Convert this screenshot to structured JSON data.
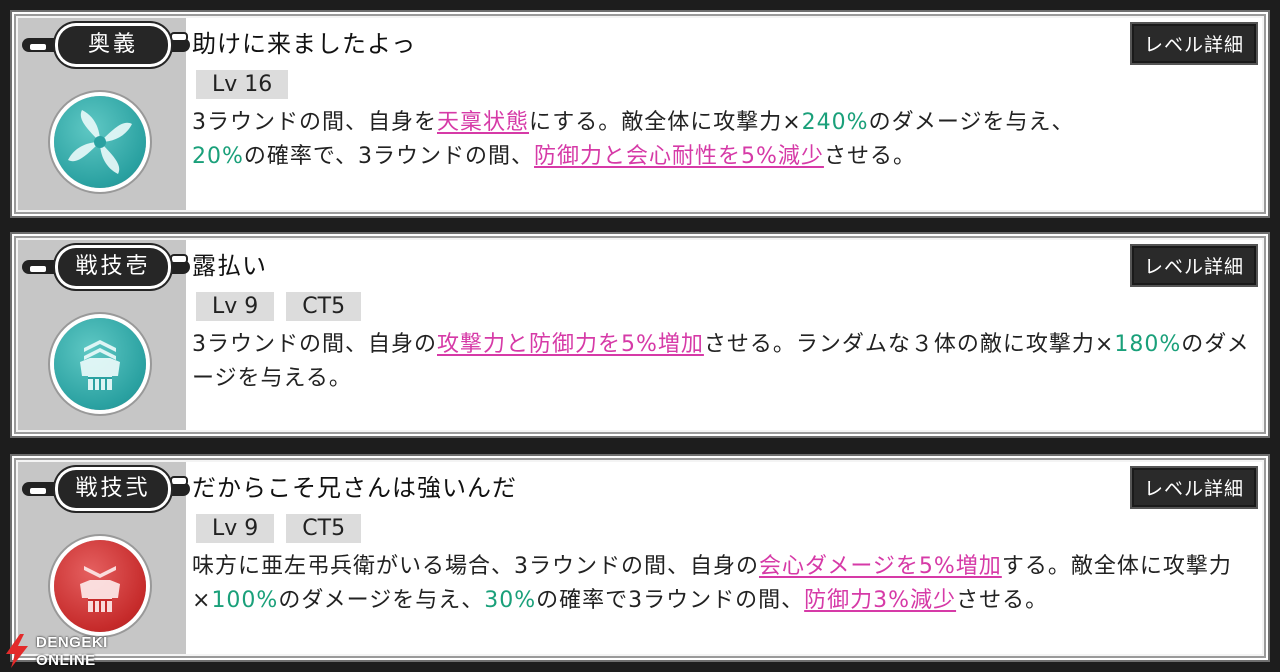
{
  "skills": [
    {
      "badge": "奥義",
      "name": "助けに来ましたよっ",
      "level_button": "レベル詳細",
      "tags": [
        "Lv 16"
      ],
      "icon": "swirl-icon",
      "icon_color": "#2aa1a1",
      "desc": [
        {
          "t": "3ラウンドの間、自身を",
          "s": "n"
        },
        {
          "t": "天稟状態",
          "s": "p"
        },
        {
          "t": "にする。敵全体に攻撃力×",
          "s": "n"
        },
        {
          "t": "240%",
          "s": "g"
        },
        {
          "t": "のダメージを与え、",
          "s": "n"
        },
        {
          "t": "20%",
          "s": "g"
        },
        {
          "t": "の確率で、3ラウンドの間、",
          "s": "n"
        },
        {
          "t": "防御力と会心耐性を5%減少",
          "s": "p"
        },
        {
          "t": "させる。",
          "s": "n"
        }
      ]
    },
    {
      "badge": "戦技壱",
      "name": "露払い",
      "level_button": "レベル詳細",
      "tags": [
        "Lv 9",
        "CT5"
      ],
      "icon": "armor-up-icon",
      "icon_color": "#2aa1a1",
      "desc": [
        {
          "t": "3ラウンドの間、自身の",
          "s": "n"
        },
        {
          "t": "攻撃力と防御力を5%増加",
          "s": "p"
        },
        {
          "t": "させる。ランダムな３体の敵に攻撃力×",
          "s": "n"
        },
        {
          "t": "180%",
          "s": "g"
        },
        {
          "t": "のダメージを与える。",
          "s": "n"
        }
      ]
    },
    {
      "badge": "戦技弐",
      "name": "だからこそ兄さんは強いんだ",
      "level_button": "レベル詳細",
      "tags": [
        "Lv 9",
        "CT5"
      ],
      "icon": "armor-down-icon",
      "icon_color": "#c62b2b",
      "desc": [
        {
          "t": "味方に亜左弔兵衛がいる場合、3ラウンドの間、自身の",
          "s": "n"
        },
        {
          "t": "会心ダメージを5%増加",
          "s": "p"
        },
        {
          "t": "する。敵全体に攻撃力×",
          "s": "n"
        },
        {
          "t": "100%",
          "s": "g"
        },
        {
          "t": "のダメージを与え、",
          "s": "n"
        },
        {
          "t": "30%",
          "s": "g"
        },
        {
          "t": "の確率で3ラウンドの間、",
          "s": "n"
        },
        {
          "t": "防御力3%減少",
          "s": "p"
        },
        {
          "t": "させる。",
          "s": "n"
        }
      ]
    }
  ],
  "watermark": {
    "line1": "DENGEKI",
    "line2": "ONLINE"
  }
}
